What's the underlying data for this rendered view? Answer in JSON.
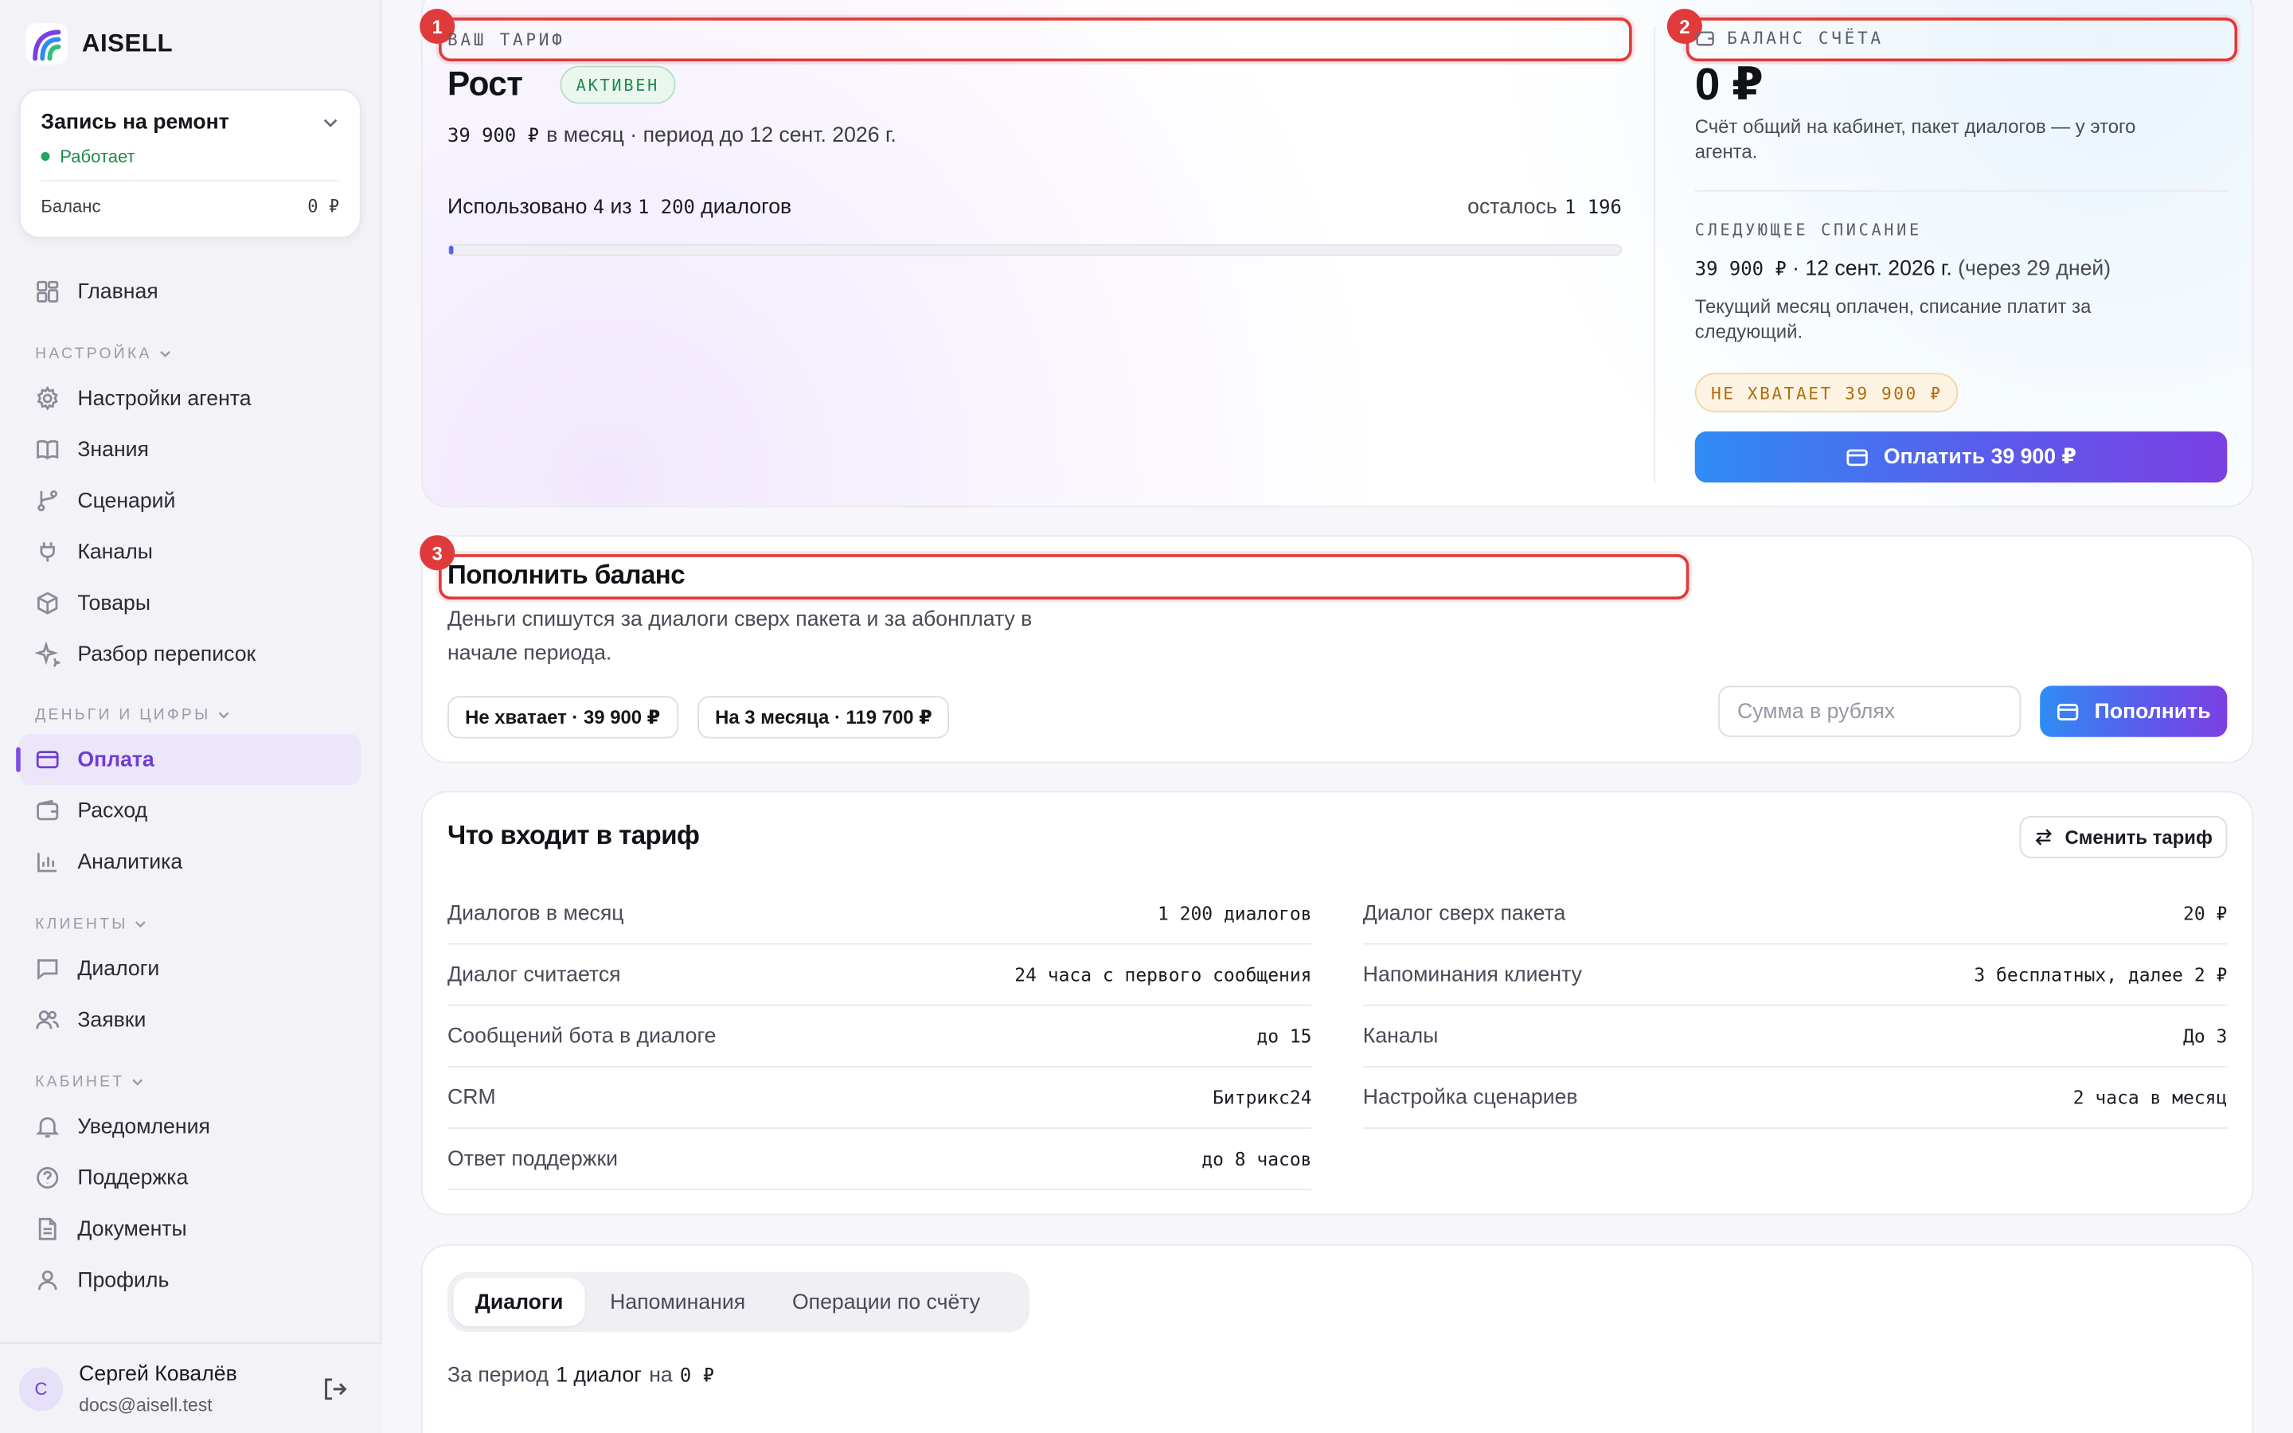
{
  "app": {
    "name": "AISELL"
  },
  "agent": {
    "name": "Запись на ремонт",
    "status": "Работает",
    "balance_label": "Баланс",
    "balance_value": "0 ₽"
  },
  "sidebar": {
    "home": "Главная",
    "sections": {
      "setup": "НАСТРОЙКА",
      "money": "ДЕНЬГИ И ЦИФРЫ",
      "clients": "КЛИЕНТЫ",
      "cabinet": "КАБИНЕТ"
    },
    "setup_items": [
      "Настройки агента",
      "Знания",
      "Сценарий",
      "Каналы",
      "Товары",
      "Разбор переписок"
    ],
    "money_items": [
      "Оплата",
      "Расход",
      "Аналитика"
    ],
    "clients_items": [
      "Диалоги",
      "Заявки"
    ],
    "cabinet_items": [
      "Уведомления",
      "Поддержка",
      "Документы",
      "Профиль"
    ]
  },
  "user": {
    "initial": "С",
    "name": "Сергей Ковалёв",
    "email": "docs@aisell.test"
  },
  "tariff": {
    "label": "ВАШ ТАРИФ",
    "name": "Рост",
    "status": "АКТИВЕН",
    "price": "39 900 ₽",
    "price_suffix": "в месяц · период до 12 сент. 2026 г.",
    "used_prefix": "Использовано",
    "used": "4",
    "used_of": "из",
    "total": "1 200",
    "used_suffix": "диалогов",
    "remaining_label": "осталось",
    "remaining": "1 196",
    "usage_fraction": 0.0033
  },
  "balance": {
    "label": "БАЛАНС СЧЁТА",
    "amount": "0 ₽",
    "note": "Счёт общий на кабинет, пакет диалогов — у этого агента.",
    "next_label": "СЛЕДУЮЩЕЕ СПИСАНИЕ",
    "next_amount": "39 900 ₽",
    "next_date": "· 12 сент. 2026 г.",
    "next_in": "(через 29 дней)",
    "next_note": "Текущий месяц оплачен, списание платит за следующий.",
    "shortage": "НЕ ХВАТАЕТ 39 900 ₽",
    "pay_button": "Оплатить 39 900 ₽"
  },
  "topup": {
    "title": "Пополнить баланс",
    "desc": "Деньги спишутся за диалоги сверх пакета и за абонплату в начале периода.",
    "chip1": "Не хватает · 39 900 ₽",
    "chip2": "На 3 месяца · 119 700 ₽",
    "placeholder": "Сумма в рублях",
    "button": "Пополнить"
  },
  "plan": {
    "title": "Что входит в тариф",
    "change_button": "Сменить тариф",
    "left": [
      {
        "k": "Диалогов в месяц",
        "v": "1 200 диалогов"
      },
      {
        "k": "Диалог считается",
        "v": "24 часа с первого сообщения"
      },
      {
        "k": "Сообщений бота в диалоге",
        "v": "до 15"
      },
      {
        "k": "CRM",
        "v": "Битрикс24"
      },
      {
        "k": "Ответ поддержки",
        "v": "до 8 часов"
      }
    ],
    "right": [
      {
        "k": "Диалог сверх пакета",
        "v": "20 ₽"
      },
      {
        "k": "Напоминания клиенту",
        "v": "3 бесплатных, далее 2 ₽"
      },
      {
        "k": "Каналы",
        "v": "До 3"
      },
      {
        "k": "Настройка сценариев",
        "v": "2 часа в месяц"
      }
    ]
  },
  "history": {
    "tabs": [
      "Диалоги",
      "Напоминания",
      "Операции по счёту"
    ],
    "summary_prefix": "За период",
    "summary_count": "1 диалог",
    "summary_mid": "на",
    "summary_amount": "0 ₽"
  },
  "annotations": [
    "1",
    "2",
    "3"
  ]
}
